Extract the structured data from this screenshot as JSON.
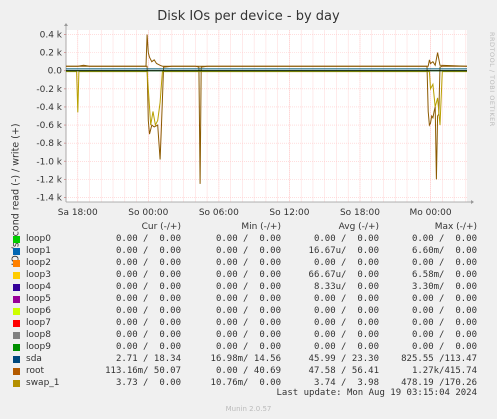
{
  "chart_data": {
    "type": "line",
    "title": "Disk IOs per device - by day",
    "ylabel": "IOs/second read (-) / write (+)",
    "ylim": [
      -1.45,
      0.45
    ],
    "y_ticks": [
      {
        "value": 0.4,
        "label": "0.4 k"
      },
      {
        "value": 0.2,
        "label": "0.2 k"
      },
      {
        "value": 0.0,
        "label": "0.0"
      },
      {
        "value": -0.2,
        "label": "-0.2 k"
      },
      {
        "value": -0.4,
        "label": "-0.4 k"
      },
      {
        "value": -0.6,
        "label": "-0.6 k"
      },
      {
        "value": -0.8,
        "label": "-0.8 k"
      },
      {
        "value": -1.0,
        "label": "-1.0 k"
      },
      {
        "value": -1.2,
        "label": "-1.2 k"
      },
      {
        "value": -1.4,
        "label": "-1.4 k"
      }
    ],
    "x_ticks": [
      {
        "value": 0,
        "label": "Sa 18:00"
      },
      {
        "value": 6,
        "label": "So 00:00"
      },
      {
        "value": 12,
        "label": "So 06:00"
      },
      {
        "value": 18,
        "label": "So 12:00"
      },
      {
        "value": 24,
        "label": "So 18:00"
      },
      {
        "value": 30,
        "label": "Mo 00:00"
      }
    ],
    "xlim": [
      -1.0,
      33.1
    ],
    "grid": true,
    "series": [
      {
        "name": "root",
        "color": "#8c5a00",
        "x": [
          -1.0,
          0.0,
          0.5,
          1.0,
          2.0,
          4.0,
          5.9,
          6.0,
          6.1,
          6.3,
          6.5,
          6.8,
          7.0,
          7.1,
          7.3,
          8.0,
          9.0,
          10.0,
          10.3,
          10.4,
          10.5,
          11.0,
          12.0,
          14.0,
          16.0,
          18.0,
          20.0,
          22.0,
          24.0,
          26.0,
          28.0,
          29.0,
          29.7,
          29.8,
          29.9,
          30.0,
          30.1,
          30.2,
          30.3,
          30.4,
          30.5,
          30.6,
          30.7,
          30.8,
          31.0,
          32.0,
          33.1
        ],
        "y": [
          0.05,
          0.05,
          0.06,
          0.05,
          0.05,
          0.05,
          0.05,
          -0.55,
          -0.7,
          -0.6,
          -0.62,
          -0.6,
          -0.98,
          -0.65,
          0.04,
          0.05,
          0.05,
          0.05,
          0.04,
          -1.25,
          0.04,
          0.05,
          0.05,
          0.05,
          0.05,
          0.05,
          0.05,
          0.05,
          0.05,
          0.05,
          0.05,
          0.05,
          0.05,
          -0.45,
          -0.6,
          -0.58,
          -0.5,
          -0.52,
          -0.45,
          -0.4,
          -1.2,
          -0.5,
          -0.48,
          0.04,
          0.05,
          0.05,
          0.05
        ]
      },
      {
        "name": "root write",
        "color": "#8c5a00",
        "x": [
          -1.0,
          5.8,
          5.9,
          6.0,
          6.1,
          6.3,
          6.5,
          6.7,
          7.0,
          7.2,
          8.0,
          29.8,
          29.9,
          30.0,
          30.2,
          30.4,
          30.6,
          30.8,
          33.1
        ],
        "y": [
          0.05,
          0.05,
          0.4,
          0.2,
          0.15,
          0.1,
          0.12,
          0.08,
          0.06,
          0.05,
          0.05,
          0.05,
          0.12,
          0.08,
          0.1,
          0.06,
          0.2,
          0.06,
          0.05
        ]
      },
      {
        "name": "swap_1",
        "color": "#b8a000",
        "x": [
          -1.0,
          -0.1,
          0.0,
          0.1,
          1.0,
          5.9,
          6.0,
          6.2,
          6.4,
          6.6,
          6.8,
          7.0,
          7.2,
          8.0,
          29.9,
          30.0,
          30.2,
          30.4,
          30.6,
          30.8,
          31.0,
          33.1
        ],
        "y": [
          -0.01,
          -0.01,
          -0.46,
          -0.01,
          -0.01,
          -0.01,
          -0.2,
          -0.6,
          -0.45,
          -0.6,
          -0.55,
          -0.35,
          -0.01,
          -0.01,
          -0.01,
          -0.2,
          -0.15,
          -0.4,
          -0.3,
          -0.6,
          -0.01,
          -0.01
        ]
      },
      {
        "name": "sda",
        "color": "#005a78",
        "x": [
          -1.0,
          33.1
        ],
        "y": [
          0.02,
          0.02
        ]
      },
      {
        "name": "loop0",
        "color": "#00cc00",
        "x": [
          -1.0,
          33.1
        ],
        "y": [
          0.0,
          0.0
        ]
      }
    ],
    "legend": {
      "headers": [
        "Cur (-/+)",
        "Min (-/+)",
        "Avg (-/+)",
        "Max (-/+)"
      ],
      "rows": [
        {
          "name": "loop0",
          "color": "#00cc00",
          "cur": "0.00 /  0.00",
          "min": "0.00 /  0.00",
          "avg": "0.00 /  0.00",
          "max": "0.00 /  0.00"
        },
        {
          "name": "loop1",
          "color": "#0066b3",
          "cur": "0.00 /  0.00",
          "min": "0.00 /  0.00",
          "avg": "16.67u/  0.00",
          "max": "6.60m/  0.00"
        },
        {
          "name": "loop2",
          "color": "#ff8000",
          "cur": "0.00 /  0.00",
          "min": "0.00 /  0.00",
          "avg": "0.00 /  0.00",
          "max": "0.00 /  0.00"
        },
        {
          "name": "loop3",
          "color": "#ffcc00",
          "cur": "0.00 /  0.00",
          "min": "0.00 /  0.00",
          "avg": "66.67u/  0.00",
          "max": "6.58m/  0.00"
        },
        {
          "name": "loop4",
          "color": "#330099",
          "cur": "0.00 /  0.00",
          "min": "0.00 /  0.00",
          "avg": "8.33u/  0.00",
          "max": "3.30m/  0.00"
        },
        {
          "name": "loop5",
          "color": "#990099",
          "cur": "0.00 /  0.00",
          "min": "0.00 /  0.00",
          "avg": "0.00 /  0.00",
          "max": "0.00 /  0.00"
        },
        {
          "name": "loop6",
          "color": "#ccff00",
          "cur": "0.00 /  0.00",
          "min": "0.00 /  0.00",
          "avg": "0.00 /  0.00",
          "max": "0.00 /  0.00"
        },
        {
          "name": "loop7",
          "color": "#ff0000",
          "cur": "0.00 /  0.00",
          "min": "0.00 /  0.00",
          "avg": "0.00 /  0.00",
          "max": "0.00 /  0.00"
        },
        {
          "name": "loop8",
          "color": "#808080",
          "cur": "0.00 /  0.00",
          "min": "0.00 /  0.00",
          "avg": "0.00 /  0.00",
          "max": "0.00 /  0.00"
        },
        {
          "name": "loop9",
          "color": "#008f00",
          "cur": "0.00 /  0.00",
          "min": "0.00 /  0.00",
          "avg": "0.00 /  0.00",
          "max": "0.00 /  0.00"
        },
        {
          "name": "sda",
          "color": "#00487d",
          "cur": "2.71 / 18.34",
          "min": "16.98m/ 14.56",
          "avg": "45.99 / 23.30",
          "max": "825.55 /113.47"
        },
        {
          "name": "root",
          "color": "#b35a00",
          "cur": "113.16m/ 50.07",
          "min": "0.00 / 40.69",
          "avg": "47.58 / 56.41",
          "max": "1.27k/415.74"
        },
        {
          "name": "swap_1",
          "color": "#b38f00",
          "cur": "3.73 /  0.00",
          "min": "10.76m/  0.00",
          "avg": "3.74 /  3.98",
          "max": "478.19 /170.26"
        }
      ]
    }
  },
  "side_label": "RRDTOOL / TOBI OETIKER",
  "last_update": "Last update: Mon Aug 19 03:15:04 2024",
  "footer": "Munin 2.0.57"
}
